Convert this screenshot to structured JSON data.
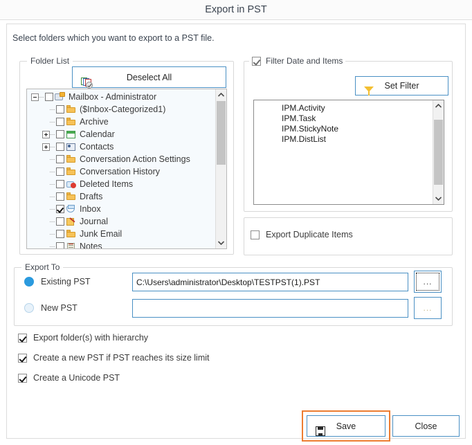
{
  "window": {
    "title": "Export in PST"
  },
  "intro": "Select folders which you want to export to a PST file.",
  "folder_panel": {
    "title": "Folder List",
    "deselect_all_label": "Deselect All",
    "deselect_all_icon": "deselect-all-icon",
    "tree": [
      {
        "label": "Mailbox - Administrator",
        "level": 0,
        "expander": "minus",
        "checked": false,
        "icon": "mailbox-icon"
      },
      {
        "label": "($Inbox-Categorized1)",
        "level": 1,
        "expander": "none",
        "checked": false,
        "icon": "folder-icon"
      },
      {
        "label": "Archive",
        "level": 1,
        "expander": "none",
        "checked": false,
        "icon": "folder-icon"
      },
      {
        "label": "Calendar",
        "level": 1,
        "expander": "plus",
        "checked": false,
        "icon": "calendar-icon"
      },
      {
        "label": "Contacts",
        "level": 1,
        "expander": "plus",
        "checked": false,
        "icon": "contacts-icon"
      },
      {
        "label": "Conversation Action Settings",
        "level": 1,
        "expander": "none",
        "checked": false,
        "icon": "folder-icon"
      },
      {
        "label": "Conversation History",
        "level": 1,
        "expander": "none",
        "checked": false,
        "icon": "folder-icon"
      },
      {
        "label": "Deleted Items",
        "level": 1,
        "expander": "none",
        "checked": false,
        "icon": "deleted-items-icon"
      },
      {
        "label": "Drafts",
        "level": 1,
        "expander": "none",
        "checked": false,
        "icon": "folder-icon"
      },
      {
        "label": "Inbox",
        "level": 1,
        "expander": "none",
        "checked": true,
        "icon": "inbox-icon"
      },
      {
        "label": "Journal",
        "level": 1,
        "expander": "none",
        "checked": false,
        "icon": "journal-icon"
      },
      {
        "label": "Junk Email",
        "level": 1,
        "expander": "none",
        "checked": false,
        "icon": "folder-icon"
      },
      {
        "label": "Notes",
        "level": 1,
        "expander": "none",
        "checked": false,
        "icon": "notes-icon"
      }
    ],
    "scrollbar": {
      "up_arrow": "▲",
      "down_arrow": "▼"
    }
  },
  "filter_panel": {
    "title": "Filter Date and Items",
    "title_checked": true,
    "set_filter_label": "Set Filter",
    "set_filter_icon": "funnel-icon",
    "items": [
      "IPM.Activity",
      "IPM.Task",
      "IPM.StickyNote",
      "IPM.DistList"
    ]
  },
  "duplicate_panel": {
    "label": "Export Duplicate Items",
    "checked": false
  },
  "export_to": {
    "title": "Export To",
    "existing": {
      "label": "Existing PST",
      "selected": true,
      "value": "C:\\Users\\administrator\\Desktop\\TESTPST(1).PST",
      "browse_label": "..."
    },
    "new": {
      "label": "New PST",
      "selected": false,
      "value": "",
      "placeholder": "",
      "browse_label": "..."
    }
  },
  "options": [
    {
      "label": "Export folder(s) with hierarchy",
      "checked": true
    },
    {
      "label": "Create a new PST if PST reaches its size limit",
      "checked": true
    },
    {
      "label": "Create a Unicode PST",
      "checked": true
    }
  ],
  "footer": {
    "save_label": "Save",
    "save_icon": "floppy-disk-icon",
    "close_label": "Close",
    "highlight_color": "#ed7d31"
  }
}
